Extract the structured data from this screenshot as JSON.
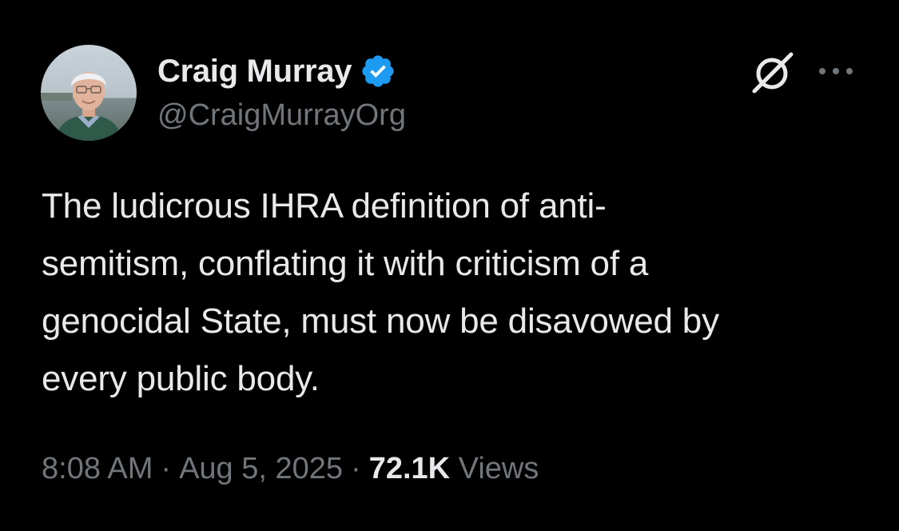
{
  "author": {
    "display_name": "Craig Murray",
    "handle": "@CraigMurrayOrg",
    "verified": true,
    "avatar_icon": "profile-photo"
  },
  "tweet": {
    "text": "The ludicrous IHRA definition of anti-\nsemitism, conflating it with criticism of a\ngenocidal State, must now be disavowed by\nevery public body."
  },
  "meta": {
    "time": "8:08 AM",
    "separator": "·",
    "date": "Aug 5, 2025",
    "views_count": "72.1K",
    "views_label": "Views"
  },
  "actions": {
    "grok_icon": "grok-icon",
    "more_icon": "more-icon"
  },
  "colors": {
    "background": "#000000",
    "primary_text": "#e7e9ea",
    "secondary_text": "#71767b",
    "verified_blue": "#1d9bf0"
  }
}
